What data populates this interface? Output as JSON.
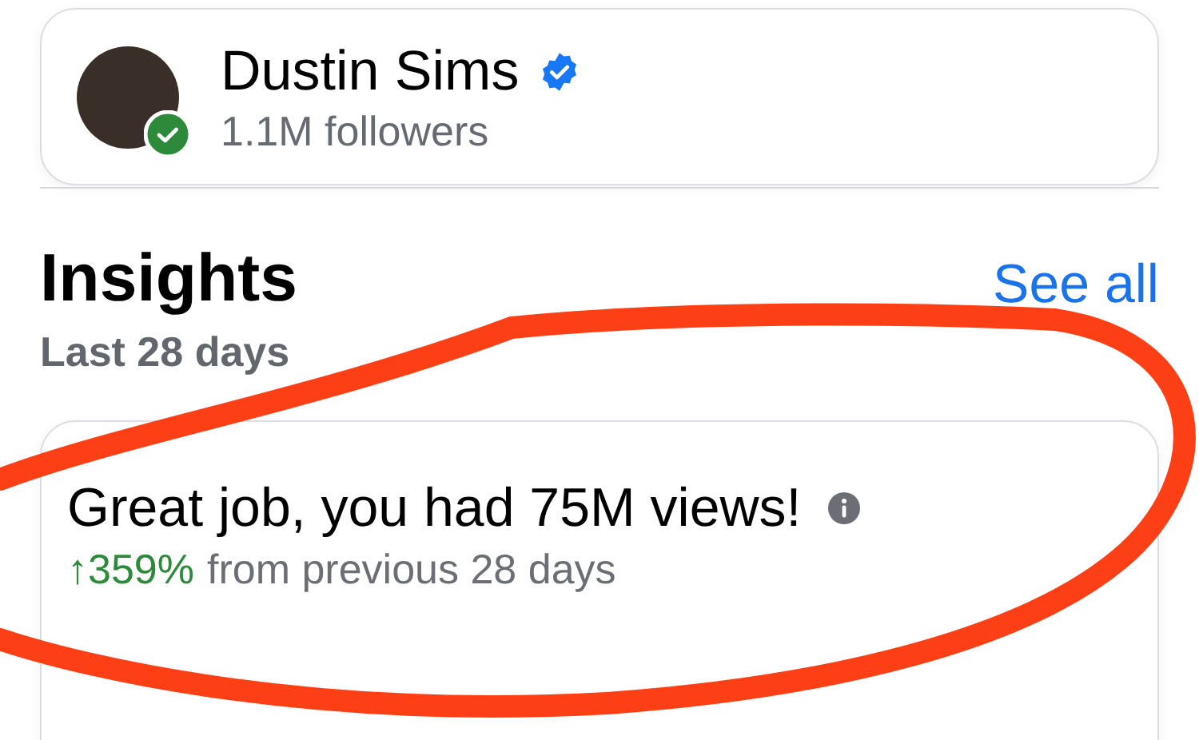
{
  "profile": {
    "name": "Dustin Sims",
    "verified": true,
    "online_check": true,
    "followers": "1.1M followers"
  },
  "insights": {
    "title": "Insights",
    "link": "See all",
    "period": "Last 28 days"
  },
  "highlight": {
    "headline": "Great job, you had 75M views!",
    "change_arrow": "↑",
    "change": "359%",
    "change_text": "from previous 28 days"
  },
  "annotation": {
    "kind": "circle-scribble"
  }
}
